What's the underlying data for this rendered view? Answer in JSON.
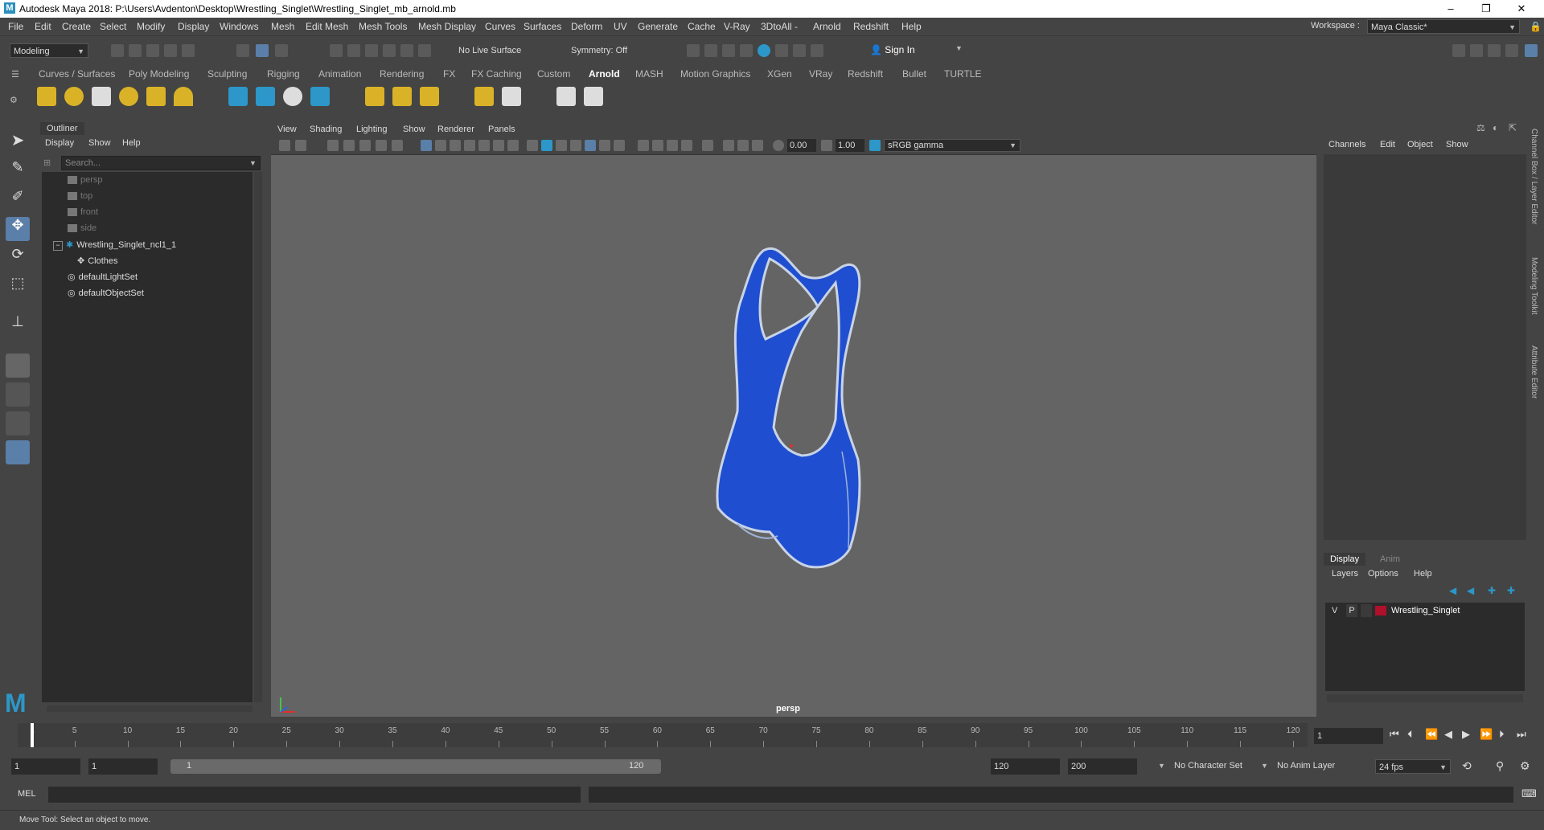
{
  "window": {
    "title": "Autodesk Maya 2018: P:\\Users\\Avdenton\\Desktop\\Wrestling_Singlet\\Wrestling_Singlet_mb_arnold.mb",
    "controls": [
      "–",
      "❐",
      "✕"
    ]
  },
  "menubar": {
    "items": [
      "File",
      "Edit",
      "Create",
      "Select",
      "Modify",
      "Display",
      "Windows",
      "Mesh",
      "Edit Mesh",
      "Mesh Tools",
      "Mesh Display",
      "Curves",
      "Surfaces",
      "Deform",
      "UV",
      "Generate",
      "Cache",
      "V-Ray",
      "3DtoAll -",
      "Arnold",
      "Redshift",
      "Help"
    ],
    "workspace_label": "Workspace :",
    "workspace_value": "Maya Classic*"
  },
  "statusline": {
    "mode": "Modeling",
    "live_surface": "No Live Surface",
    "symmetry": "Symmetry: Off",
    "sign_in": "Sign In"
  },
  "shelf": {
    "tabs": [
      "Curves / Surfaces",
      "Poly Modeling",
      "Sculpting",
      "Rigging",
      "Animation",
      "Rendering",
      "FX",
      "FX Caching",
      "Custom",
      "Arnold",
      "MASH",
      "Motion Graphics",
      "XGen",
      "VRay",
      "Redshift",
      "Bullet",
      "TURTLE"
    ],
    "active_tab": "Arnold"
  },
  "outliner": {
    "title": "Outliner",
    "menu": [
      "Display",
      "Show",
      "Help"
    ],
    "search_placeholder": "Search...",
    "items": [
      {
        "label": "persp",
        "type": "camera",
        "dim": true
      },
      {
        "label": "top",
        "type": "camera",
        "dim": true
      },
      {
        "label": "front",
        "type": "camera",
        "dim": true
      },
      {
        "label": "side",
        "type": "camera",
        "dim": true
      },
      {
        "label": "Wrestling_Singlet_ncl1_1",
        "type": "nucleus",
        "dim": false
      },
      {
        "label": "Clothes",
        "type": "group",
        "dim": false
      },
      {
        "label": "defaultLightSet",
        "type": "set",
        "dim": false
      },
      {
        "label": "defaultObjectSet",
        "type": "set",
        "dim": false
      }
    ],
    "collapse_symbol": "−"
  },
  "viewport": {
    "menu": [
      "View",
      "Shading",
      "Lighting",
      "Show",
      "Renderer",
      "Panels"
    ],
    "exposure": "0.00",
    "gamma": "1.00",
    "color_space": "sRGB gamma",
    "camera_label": "persp",
    "object_color": "#1f4fd0"
  },
  "channelbox": {
    "menu": [
      "Channels",
      "Edit",
      "Object",
      "Show"
    ],
    "layer_tabs": [
      "Display",
      "Anim"
    ],
    "layer_menu": [
      "Layers",
      "Options",
      "Help"
    ],
    "layer": {
      "v": "V",
      "p": "P",
      "name": "Wrestling_Singlet",
      "color": "#b0102a"
    }
  },
  "side_tabs": [
    "Channel Box / Layer Editor",
    "Modeling Toolkit",
    "Attribute Editor"
  ],
  "timeline": {
    "ticks": [
      "1",
      "5",
      "10",
      "15",
      "20",
      "25",
      "30",
      "35",
      "40",
      "45",
      "50",
      "55",
      "60",
      "65",
      "70",
      "75",
      "80",
      "85",
      "90",
      "95",
      "100",
      "105",
      "110",
      "115",
      "120"
    ],
    "current_frame": "1"
  },
  "range": {
    "start": "1",
    "playback_start": "1",
    "slider_start": "1",
    "slider_end": "120",
    "playback_end": "120",
    "end": "200",
    "character_set": "No Character Set",
    "anim_layer": "No Anim Layer",
    "fps": "24 fps"
  },
  "command": {
    "label": "MEL"
  },
  "help": {
    "text": "Move Tool: Select an object to move."
  }
}
